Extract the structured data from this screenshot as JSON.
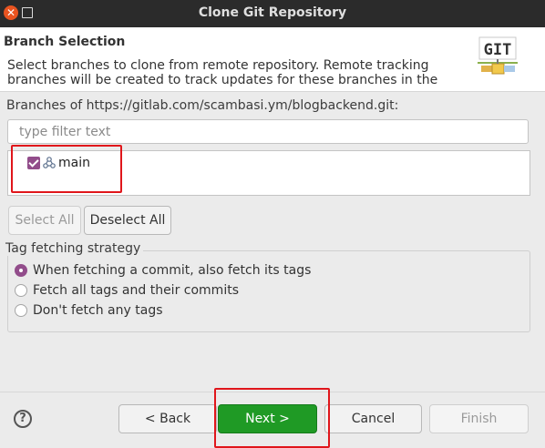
{
  "window": {
    "title": "Clone Git Repository"
  },
  "header": {
    "title": "Branch Selection",
    "description": "Select branches to clone from remote repository. Remote tracking branches will be created to track updates for these branches in the remote",
    "logo_text": "GIT"
  },
  "branches": {
    "label": "Branches of https://gitlab.com/scambasi.ym/blogbackend.git:",
    "filter_placeholder": "type filter text",
    "filter_value": "",
    "items": [
      {
        "label": "main",
        "checked": true
      }
    ]
  },
  "selection_buttons": {
    "select_all": "Select All",
    "deselect_all": "Deselect All"
  },
  "tag_strategy": {
    "label": "Tag fetching strategy",
    "options": [
      {
        "label": "When fetching a commit, also fetch its tags",
        "selected": true
      },
      {
        "label": "Fetch all tags and their commits",
        "selected": false
      },
      {
        "label": "Don't fetch any tags",
        "selected": false
      }
    ]
  },
  "footer": {
    "back": "< Back",
    "next": "Next >",
    "cancel": "Cancel",
    "finish": "Finish",
    "help": "?"
  },
  "colors": {
    "accent": "#924d8b",
    "primary_button": "#1f9a25",
    "highlight": "#e0161b",
    "titlebar": "#2b2b2b"
  }
}
